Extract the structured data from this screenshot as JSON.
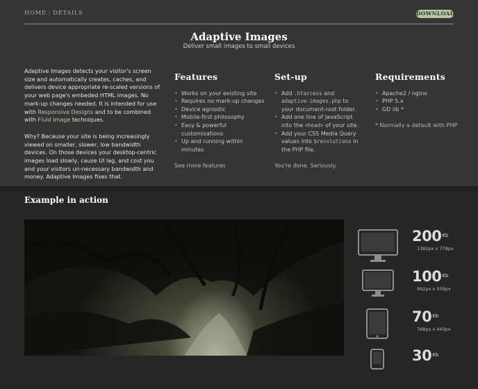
{
  "nav": {
    "home": "HOME",
    "separator": "|",
    "details": "DETAILS",
    "download": "DOWNLOAD"
  },
  "header": {
    "title": "Adaptive Images",
    "subtitle": "Deliver small images to small devices"
  },
  "intro": {
    "p1_a": "Adaptive Images detects your visitor's screen size and automatically creates, caches, and delivers device appropriate re-scaled versions of your web page's embeded HTML images. No mark-up changes needed. It is intended for use with ",
    "p1_link1": "Responsive Designs",
    "p1_b": " and to be combined with ",
    "p1_link2": "Fluid Image",
    "p1_c": " techniques.",
    "p2": "Why? Because your site is being increasingly viewed on smaller, slower, low bandwidth devices. On those devices your desktop-centric images load slowly, cause UI lag, and cost you and your visitors un-necessary bandwidth and money. Adaptive Images fixes that."
  },
  "features": {
    "title": "Features",
    "items": [
      "Works on your existing site",
      "Requires no mark-up changes",
      "Device agnostic",
      "Mobile-first philosophy",
      "Easy & powerful customisations",
      "Up and running within minutes"
    ],
    "more": "See more features"
  },
  "setup": {
    "title": "Set-up",
    "s1_a": "Add ",
    "s1_code1": ".htaccess",
    "s1_b": " and ",
    "s1_code2": "adaptive-images.php",
    "s1_c": " to your document-root folder.",
    "s2_a": "Add one line of JavaScript into the ",
    "s2_code": "<head>",
    "s2_b": " of your site.",
    "s3_a": "Add your CSS Media Query values into ",
    "s3_code": "$resolutions",
    "s3_b": " in the PHP file.",
    "done": "You're done. Seriously."
  },
  "requirements": {
    "title": "Requirements",
    "items": [
      "Apache2 / nginx",
      "PHP 5.x",
      "GD lib *"
    ],
    "note": "* Normally a default with PHP"
  },
  "example": {
    "title": "Example in action",
    "devices": [
      {
        "icon": "desktop-monitor-icon",
        "size": "200",
        "unit": "Kb",
        "res": "1382px x 778px"
      },
      {
        "icon": "laptop-monitor-icon",
        "size": "100",
        "unit": "Kb",
        "res": "992px x 559px"
      },
      {
        "icon": "tablet-icon",
        "size": "70",
        "unit": "Kb",
        "res": "768px x 443px"
      },
      {
        "icon": "phone-icon",
        "size": "30",
        "unit": "Kb",
        "res": ""
      }
    ]
  },
  "colors": {
    "accent": "#b9c6a4",
    "header_bg": "#353535",
    "page_bg": "#262626"
  }
}
